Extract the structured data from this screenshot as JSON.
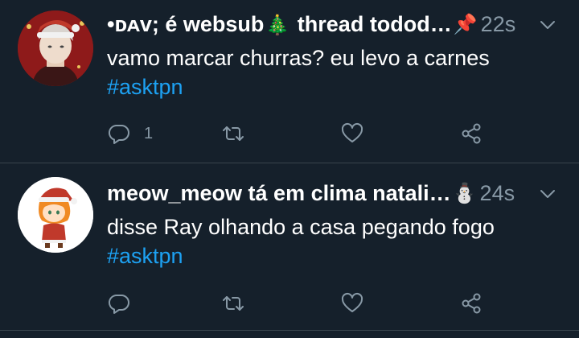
{
  "tweets": [
    {
      "display_name": "•ᴅᴀᴠ; é websub",
      "name_emoji_1": "🎄",
      "name_rest": " thread todod…",
      "name_emoji_2": "📌",
      "time": "22s",
      "text": "vamo marcar churras? eu levo a carnes",
      "hashtag": "#asktpn",
      "reply_count": "1",
      "avatar_icon": "avatar-icon"
    },
    {
      "display_name": "meow_meow tá em clima natali…",
      "name_emoji_2": "⛄",
      "time": "24s",
      "text": "disse Ray olhando a casa pegando fogo",
      "hashtag": "#asktpn",
      "reply_count": "",
      "avatar_icon": "avatar-icon"
    }
  ],
  "colors": {
    "background": "#15202b",
    "divider": "#38444d",
    "secondary_text": "#8899a6",
    "link": "#1da1f2"
  }
}
